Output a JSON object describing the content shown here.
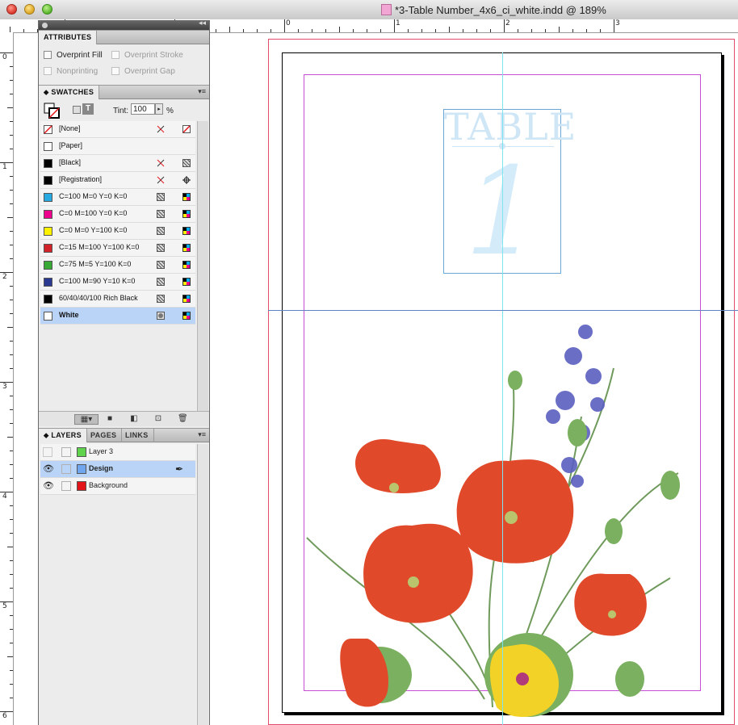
{
  "window": {
    "title": "*3-Table Number_4x6_ci_white.indd @ 189%"
  },
  "rulers": {
    "horizontal": [
      "0",
      "1",
      "2",
      "3"
    ],
    "vertical": [
      "0",
      "1",
      "2",
      "3",
      "4",
      "5",
      "6"
    ]
  },
  "attributes": {
    "tab_label": "ATTRIBUTES",
    "options": [
      {
        "label": "Overprint Fill",
        "enabled": true
      },
      {
        "label": "Overprint Stroke",
        "enabled": false
      },
      {
        "label": "Nonprinting",
        "enabled": false
      },
      {
        "label": "Overprint Gap",
        "enabled": false
      }
    ]
  },
  "swatches": {
    "tab_label": "SWATCHES",
    "tint_label": "Tint:",
    "tint_value": "100",
    "tint_unit": "%",
    "items": [
      {
        "name": "[None]",
        "color": "none",
        "icons": [
          "no-edit-icon",
          "none-icon"
        ]
      },
      {
        "name": "[Paper]",
        "color": "#ffffff",
        "icons": []
      },
      {
        "name": "[Black]",
        "color": "#000000",
        "icons": [
          "no-edit-icon",
          "process-icon"
        ]
      },
      {
        "name": "[Registration]",
        "color": "#000000",
        "icons": [
          "no-edit-icon",
          "registration-icon"
        ]
      },
      {
        "name": "C=100 M=0 Y=0 K=0",
        "color": "#27a9e1",
        "icons": [
          "process-icon",
          "cmyk-icon"
        ]
      },
      {
        "name": "C=0 M=100 Y=0 K=0",
        "color": "#ec008c",
        "icons": [
          "process-icon",
          "cmyk-icon"
        ]
      },
      {
        "name": "C=0 M=0 Y=100 K=0",
        "color": "#fff200",
        "icons": [
          "process-icon",
          "cmyk-icon"
        ]
      },
      {
        "name": "C=15 M=100 Y=100 K=0",
        "color": "#d2232a",
        "icons": [
          "process-icon",
          "cmyk-icon"
        ]
      },
      {
        "name": "C=75 M=5 Y=100 K=0",
        "color": "#39a935",
        "icons": [
          "process-icon",
          "cmyk-icon"
        ]
      },
      {
        "name": "C=100 M=90 Y=10 K=0",
        "color": "#2b3990",
        "icons": [
          "process-icon",
          "cmyk-icon"
        ]
      },
      {
        "name": "60/40/40/100 Rich Black",
        "color": "#000000",
        "icons": [
          "process-icon",
          "cmyk-icon"
        ]
      },
      {
        "name": "White",
        "color": "#ffffff",
        "icons": [
          "spot-icon",
          "cmyk-icon"
        ],
        "selected": true
      }
    ]
  },
  "layers_panel": {
    "tabs": [
      "LAYERS",
      "PAGES",
      "LINKS"
    ],
    "items": [
      {
        "name": "Layer 3",
        "color": "#5fd34b",
        "visible": false,
        "selected": false
      },
      {
        "name": "Design",
        "color": "#6fa6ee",
        "visible": true,
        "selected": true
      },
      {
        "name": "Background",
        "color": "#e2151a",
        "visible": true,
        "selected": false
      }
    ]
  },
  "document": {
    "table_word": "TABLE",
    "table_number": "1"
  },
  "colors": {
    "bleed": "#e24b69",
    "margin": "#c64fd6",
    "guide": "#7ee4ee",
    "selection": "#b9d4f6"
  }
}
